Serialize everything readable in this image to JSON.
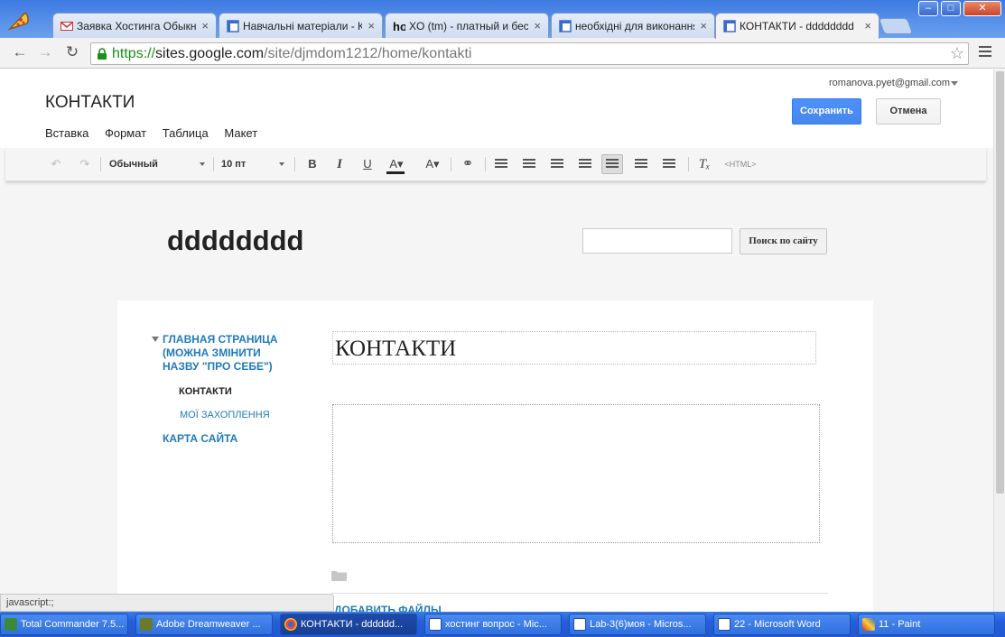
{
  "browser": {
    "tabs": [
      {
        "label": "Заявка Хостинга Обыкно",
        "icon": "gmail-icon"
      },
      {
        "label": "Навчальні матеріали - Ко",
        "icon": "sites-icon"
      },
      {
        "label": "XO (tm) - платный и бесп",
        "icon": "ho-icon"
      },
      {
        "label": "необхідні для виконання",
        "icon": "sites-icon"
      },
      {
        "label": "КОНТАКТИ - dddddddd",
        "icon": "sites-icon"
      }
    ],
    "close_glyph": "×",
    "url": {
      "scheme": "https://",
      "host": "sites.google.com",
      "path": "/site/djmdom1212/home/kontakti"
    },
    "status_text": "javascript:;"
  },
  "editor": {
    "page_name": "КОНТАКТИ",
    "menu": [
      "Вставка",
      "Формат",
      "Таблица",
      "Макет"
    ],
    "user_email": "romanova.pyet@gmail.com",
    "save_label": "Сохранить",
    "cancel_label": "Отмена",
    "style_select": "Обычный",
    "size_select": "10 пт",
    "html_label": "<HTML>"
  },
  "site": {
    "title": "dddddddd",
    "search_button": "Поиск по сайту",
    "nav": {
      "home": "ГЛАВНАЯ СТРАНИЦА (МОЖНА ЗМІНИТИ НАЗВУ \"ПРО СЕБЕ\")",
      "contacts": "КОНТАКТИ",
      "hobbies": "МОЇ ЗАХОПЛЕННЯ",
      "sitemap": "КАРТА САЙТА"
    },
    "page_heading": "КОНТАКТИ",
    "add_files": "ДОБАВИТЬ ФАЙЛЫ"
  },
  "taskbar": [
    "Total Commander 7.5...",
    "Adobe Dreamweaver ...",
    "КОНТАКТИ - dddddd...",
    "хостинг вопрос - Mic...",
    "Lab-3(6)моя - Micros...",
    "22 - Microsoft Word",
    "11 - Paint"
  ],
  "colors": {
    "accent": "#4d90fe",
    "link": "#1f7ab8",
    "taskbar": "#245edb"
  }
}
